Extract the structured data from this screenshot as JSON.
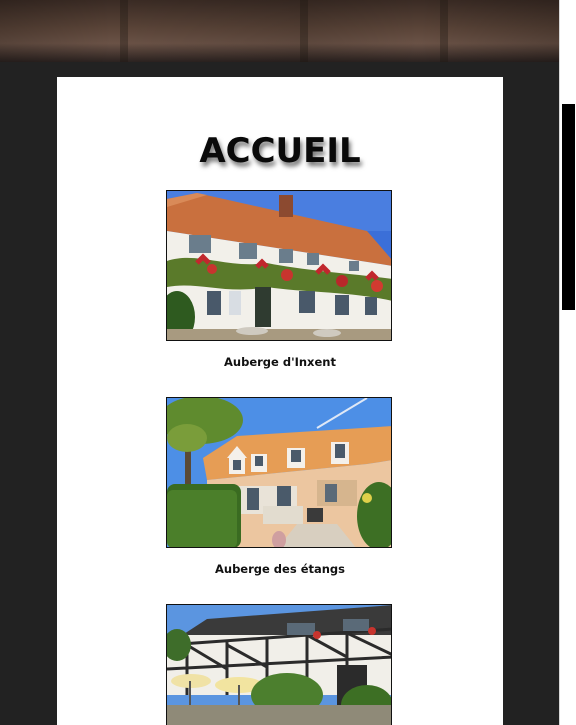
{
  "page": {
    "title": "ACCUEIL"
  },
  "gallery": [
    {
      "caption": "Auberge d'Inxent"
    },
    {
      "caption": "Auberge des étangs"
    },
    {
      "caption": ""
    }
  ]
}
